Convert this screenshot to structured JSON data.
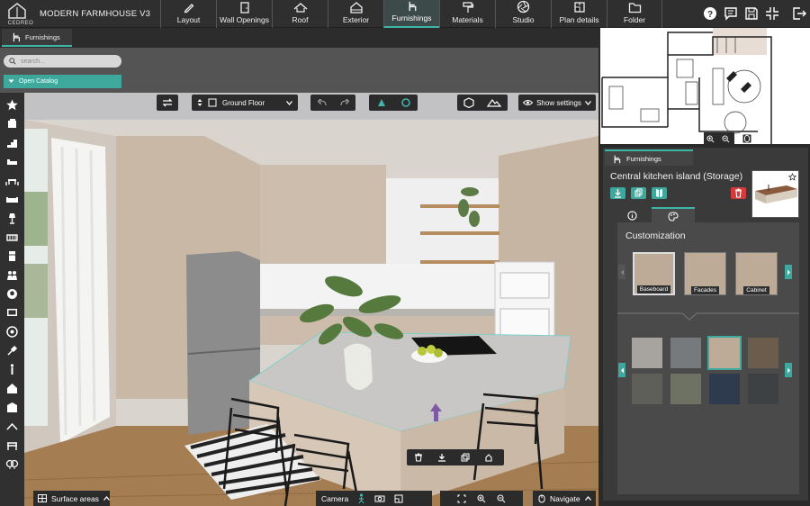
{
  "app": {
    "logo_text": "CEDREO",
    "project_title": "MODERN FARMHOUSE V3"
  },
  "nav": {
    "tabs": [
      {
        "label": "Layout",
        "icon": "pencil-icon"
      },
      {
        "label": "Wall Openings",
        "icon": "door-icon"
      },
      {
        "label": "Roof",
        "icon": "roof-icon"
      },
      {
        "label": "Exterior",
        "icon": "house-icon"
      },
      {
        "label": "Furnishings",
        "icon": "chair-icon",
        "active": true
      },
      {
        "label": "Materials",
        "icon": "paint-roller-icon"
      },
      {
        "label": "Studio",
        "icon": "aperture-icon"
      },
      {
        "label": "Plan details",
        "icon": "blueprint-icon"
      },
      {
        "label": "Folder",
        "icon": "folder-icon"
      }
    ]
  },
  "toolbar_right": [
    "help-icon",
    "comment-icon",
    "save-icon",
    "collapse-icon",
    "logout-icon"
  ],
  "section": {
    "tab_label": "Furnishings"
  },
  "catalog": {
    "search_placeholder": "search...",
    "open_label": "Open Catalog"
  },
  "viewport_controls": {
    "floor": "Ground Floor",
    "settings": "Show settings"
  },
  "bottom": {
    "surface_areas": "Surface areas",
    "camera": "Camera",
    "navigate": "Navigate"
  },
  "furnishings_panel": {
    "tab_label": "Furnishings",
    "item_title": "Central kitchen island (Storage)",
    "section_title": "Customization",
    "categories": [
      "Baseboard",
      "Facades",
      "Cabinet"
    ],
    "swatches": [
      "#a7a39f",
      "#767a7d",
      "#bdab98",
      "#6b5c4b",
      "#5d5f58",
      "#6e7263",
      "#2e3a4d",
      "#3e4144"
    ],
    "selected_swatch": 2
  },
  "colors": {
    "accent": "#3fa89d",
    "danger": "#d63a3a"
  }
}
